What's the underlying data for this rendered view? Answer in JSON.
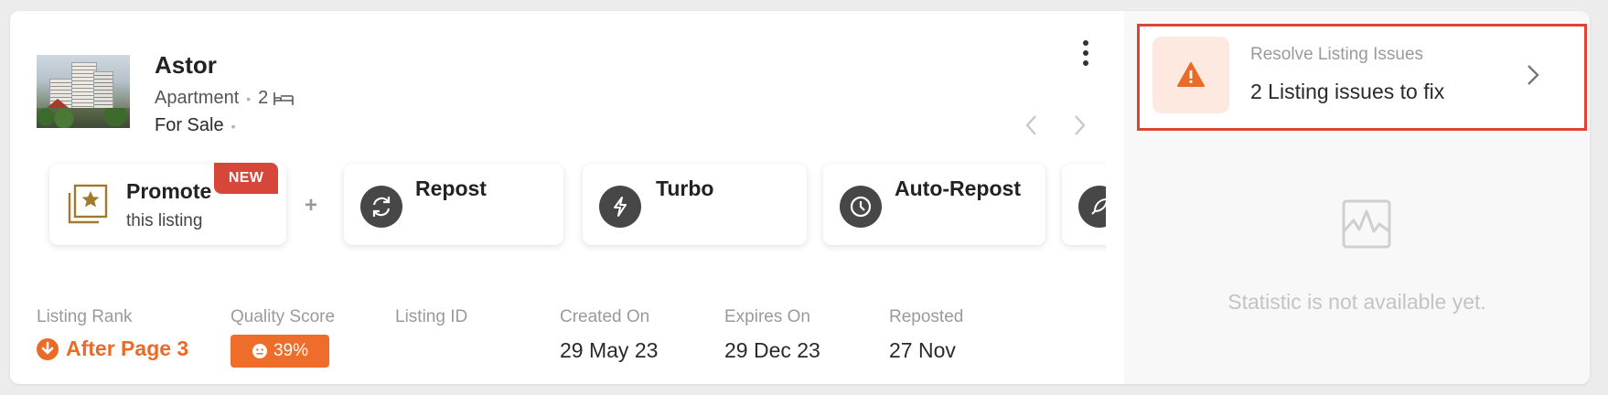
{
  "listing": {
    "title": "Astor",
    "property_type": "Apartment",
    "bedrooms": "2",
    "status": "For Sale"
  },
  "actions": {
    "promote_label": "Promote",
    "promote_sub": "this listing",
    "new_badge": "NEW",
    "plus": "+",
    "repost_label": "Repost",
    "turbo_label": "Turbo",
    "auto_repost_label": "Auto-Repost"
  },
  "stats": {
    "rank_label": "Listing Rank",
    "rank_value": "After Page 3",
    "quality_label": "Quality Score",
    "quality_value": "39%",
    "listing_id_label": "Listing ID",
    "listing_id_value": "",
    "created_label": "Created On",
    "created_value": "29 May 23",
    "expires_label": "Expires On",
    "expires_value": "29 Dec 23",
    "reposted_label": "Reposted",
    "reposted_value": "27 Nov"
  },
  "issues": {
    "title": "Resolve Listing Issues",
    "text": "2 Listing issues to fix"
  },
  "statistics": {
    "empty_text": "Statistic is not available yet."
  },
  "colors": {
    "accent_orange": "#ec6a28",
    "badge_red": "#d6473a",
    "issue_border": "#de4433",
    "tile_icon": "#474747",
    "promote_gold": "#a07a2e"
  },
  "icons": {
    "bed": "bed-icon",
    "kebab": "more-vertical-icon",
    "prev": "chevron-left-icon",
    "next": "chevron-right-icon",
    "promote": "star-gallery-icon",
    "repost": "refresh-icon",
    "turbo": "lightning-icon",
    "auto_repost": "clock-icon",
    "rank": "arrow-down-circle-icon",
    "quality": "face-icon",
    "warning": "warning-icon",
    "stats": "chart-icon"
  }
}
